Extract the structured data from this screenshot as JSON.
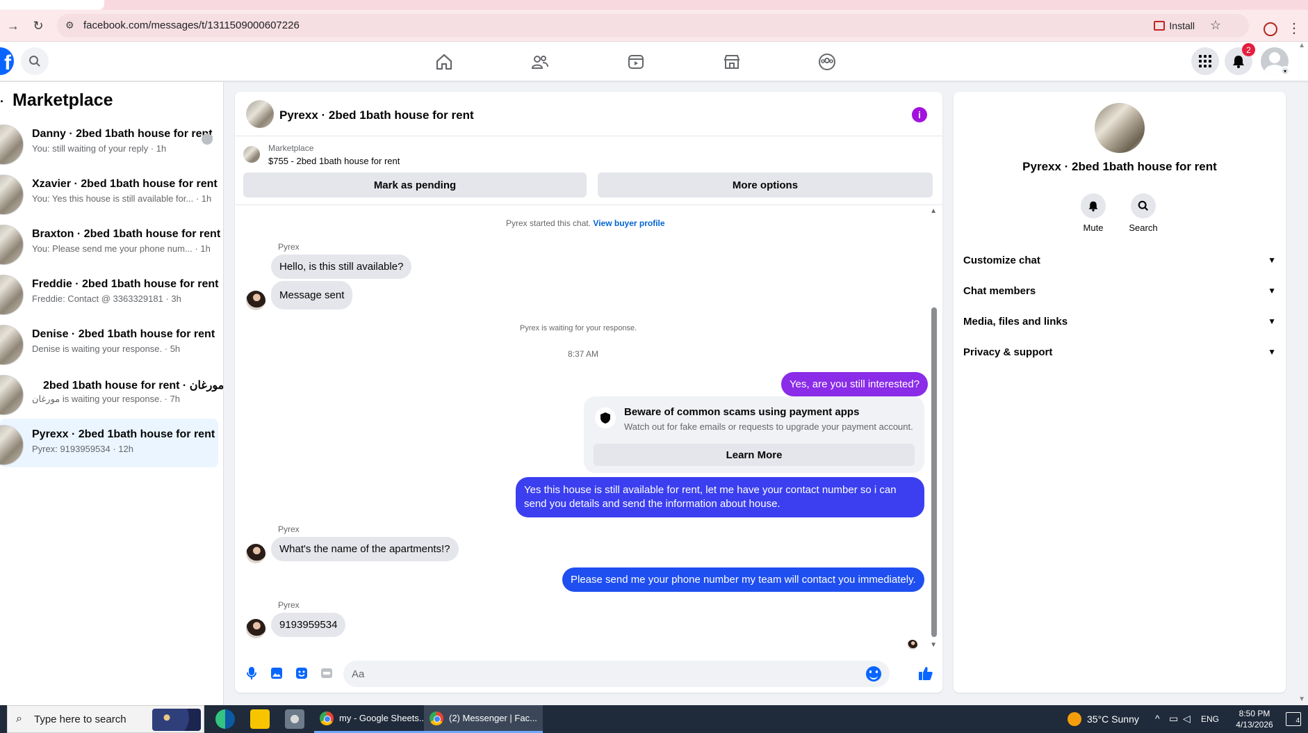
{
  "browser": {
    "url": "facebook.com/messages/t/1311509000607226",
    "install_label": "Install"
  },
  "fb_header": {
    "notification_count": "2"
  },
  "left": {
    "title": "Marketplace",
    "conversations": [
      {
        "name": "Danny · 2bed 1bath house for rent",
        "preview": "You: still waiting of your reply · 1h"
      },
      {
        "name": "Xzavier · 2bed 1bath house for rent",
        "preview": "You: Yes this house is still available for... · 1h"
      },
      {
        "name": "Braxton · 2bed 1bath house for rent",
        "preview": "You: Please send me your phone num... · 1h"
      },
      {
        "name": "Freddie · 2bed 1bath house for rent",
        "preview": "Freddie: Contact @ 3363329181 · 3h"
      },
      {
        "name": "Denise · 2bed 1bath house for rent",
        "preview": "Denise is waiting your response. · 5h"
      },
      {
        "name": "مورغان · 2bed 1bath house for rent",
        "preview": "مورغان is waiting your response. · 7h"
      },
      {
        "name": "Pyrexx · 2bed 1bath house for rent",
        "preview": "Pyrex: 9193959534 · 12h"
      }
    ]
  },
  "chat": {
    "title": "Pyrexx · 2bed 1bath house for rent",
    "marketplace_label": "Marketplace",
    "listing": "$755 - 2bed 1bath house for rent",
    "mark_pending": "Mark as pending",
    "more_options": "More options",
    "started_text": "Pyrex started this chat.",
    "view_buyer": "View buyer profile",
    "sender_name": "Pyrex",
    "msg1": "Hello, is this still available?",
    "msg2": "Message sent",
    "waiting": "Pyrex is waiting for your response.",
    "time": "8:37 AM",
    "out1": "Yes, are you still interested?",
    "warn_title": "Beware of common scams using payment apps",
    "warn_sub": "Watch out for fake emails or requests to upgrade your payment account.",
    "learn_more": "Learn More",
    "out2": "Yes this house is still available for rent, let me have your contact number so i can send you details and send the information about house.",
    "msg3": "What's the name of the apartments!?",
    "out3": "Please send me your phone number my team will contact you immediately.",
    "msg4": "9193959534",
    "composer_placeholder": "Aa"
  },
  "right": {
    "name": "Pyrexx · 2bed 1bath house for rent",
    "mute": "Mute",
    "search": "Search",
    "sections": [
      "Customize chat",
      "Chat members",
      "Media, files and links",
      "Privacy & support"
    ]
  },
  "taskbar": {
    "search_placeholder": "Type here to search",
    "task1": "my - Google Sheets...",
    "task2": "(2) Messenger | Fac...",
    "weather": "35°C  Sunny",
    "lang": "ENG",
    "time": "8:50 PM",
    "date": "4/13/2026",
    "notif": "4"
  },
  "colors": {
    "fb_blue": "#0866ff",
    "bubble_purple": "#8a2ce8",
    "bubble_blue": "#1f4ff0",
    "info_purple": "#a212de"
  }
}
